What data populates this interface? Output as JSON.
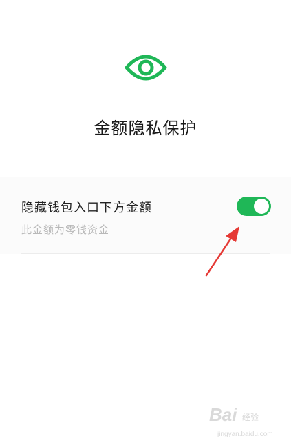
{
  "header": {
    "icon": "eye-icon",
    "title": "金额隐私保护"
  },
  "setting": {
    "label": "隐藏钱包入口下方金额",
    "description": "此金额为零钱资金",
    "toggle_on": true
  },
  "colors": {
    "accent": "#1fb757",
    "annotation": "#e53935"
  },
  "watermark": {
    "main": "Bai",
    "sub": "经验",
    "url": "jingyan.baidu.com"
  }
}
